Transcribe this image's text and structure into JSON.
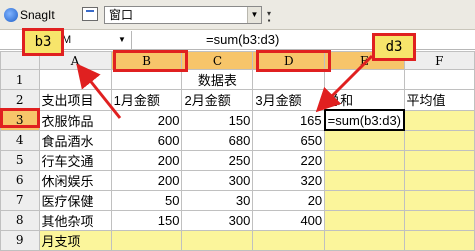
{
  "snagit_bar": {
    "app_label": "SnagIt",
    "window_select_value": "窗口"
  },
  "formula_bar": {
    "name_box": "M",
    "formula": "=sum(b3:d3)"
  },
  "columns": [
    "A",
    "B",
    "C",
    "D",
    "E",
    "F"
  ],
  "rows": [
    {
      "num": "1",
      "cells": [
        "",
        "",
        "数据表",
        "",
        "",
        ""
      ]
    },
    {
      "num": "2",
      "cells": [
        "支出项目",
        "1月金额",
        "2月金额",
        "3月金额",
        "总和",
        "平均值"
      ]
    },
    {
      "num": "3",
      "cells": [
        "衣服饰品",
        "200",
        "150",
        "165",
        "=sum(b3:d3)",
        ""
      ]
    },
    {
      "num": "4",
      "cells": [
        "食品酒水",
        "600",
        "680",
        "650",
        "",
        ""
      ]
    },
    {
      "num": "5",
      "cells": [
        "行车交通",
        "200",
        "250",
        "220",
        "",
        ""
      ]
    },
    {
      "num": "6",
      "cells": [
        "休闲娱乐",
        "200",
        "300",
        "320",
        "",
        ""
      ]
    },
    {
      "num": "7",
      "cells": [
        "医疗保健",
        "50",
        "30",
        "20",
        "",
        ""
      ]
    },
    {
      "num": "8",
      "cells": [
        "其他杂项",
        "150",
        "300",
        "400",
        "",
        ""
      ]
    },
    {
      "num": "9",
      "cells": [
        "月支项",
        "",
        "",
        "",
        "",
        ""
      ]
    }
  ],
  "annotations": {
    "callout_b3": "b3",
    "callout_d3": "d3",
    "highlight_color": "#e02020",
    "callout_fill": "#f7e56b"
  },
  "colors": {
    "selected_header": "#f7c56a",
    "total_avg_fill": "#fbf59b"
  }
}
